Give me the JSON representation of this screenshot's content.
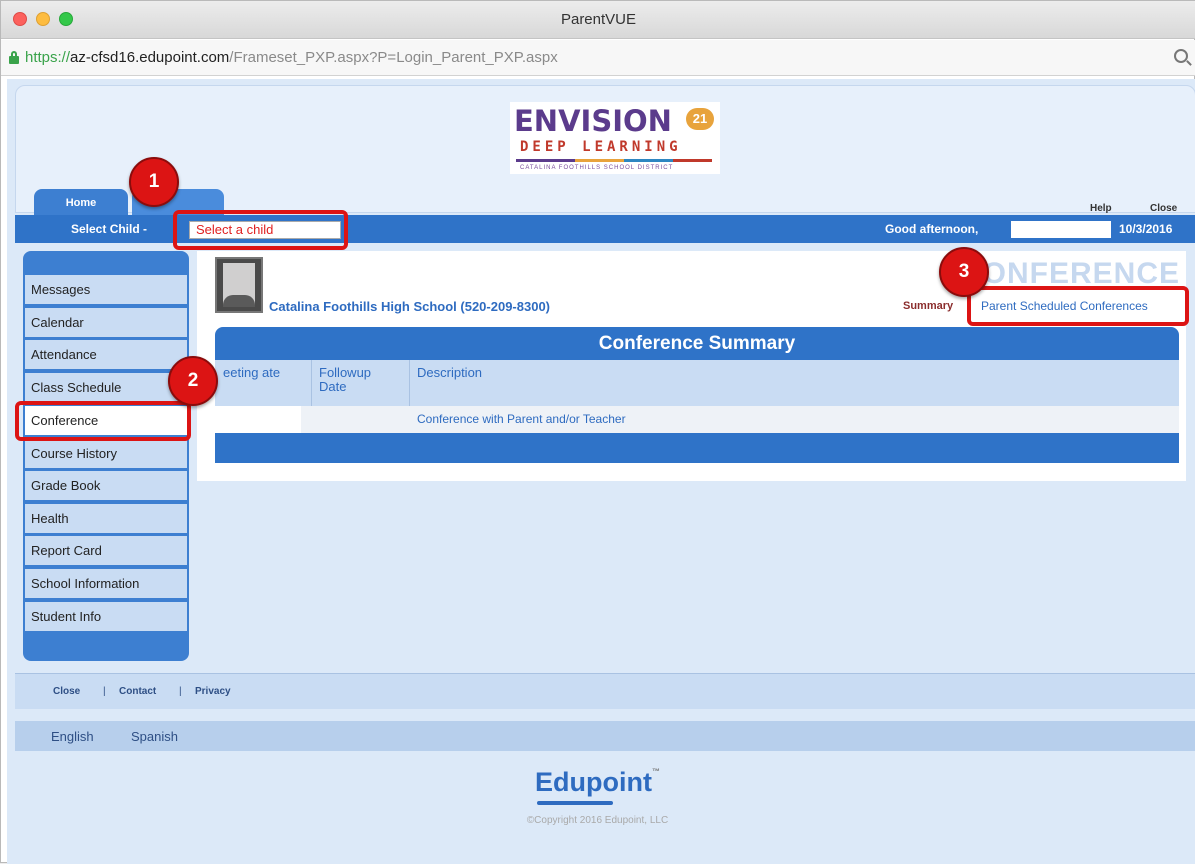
{
  "window": {
    "title": "ParentVUE"
  },
  "urlbar": {
    "scheme": "https://",
    "host": "az-cfsd16.edupoint.com",
    "path": "/Frameset_PXP.aspx?P=Login_Parent_PXP.aspx"
  },
  "logo": {
    "title": "ENVISION",
    "badge": "21",
    "subtitle": "DEEP LEARNING",
    "district": "CATALINA FOOTHILLS SCHOOL DISTRICT"
  },
  "tabs": {
    "home": "Home",
    "second": ""
  },
  "toplinks": {
    "help": "Help",
    "close": "Close"
  },
  "childbar": {
    "label": "Select Child -",
    "select_value": "Select a child",
    "greeting": "Good afternoon,",
    "date": "10/3/2016"
  },
  "sidebar": {
    "items": [
      {
        "label": "Messages"
      },
      {
        "label": "Calendar"
      },
      {
        "label": "Attendance"
      },
      {
        "label": "Class Schedule"
      },
      {
        "label": "Conference"
      },
      {
        "label": "Course History"
      },
      {
        "label": "Grade Book"
      },
      {
        "label": "Health"
      },
      {
        "label": "Report Card"
      },
      {
        "label": "School Information"
      },
      {
        "label": "Student Info"
      }
    ]
  },
  "content": {
    "school": "Catalina Foothills High School (520-209-8300)",
    "watermark": "ONFERENCE",
    "summary_label": "Summary",
    "parent_link": "Parent Scheduled Conferences",
    "table": {
      "title": "Conference Summary",
      "columns": [
        "eeting ate",
        "Followup Date",
        "Description"
      ],
      "rows": [
        {
          "meeting_date": "",
          "followup_date": "",
          "description": "Conference with Parent and/or Teacher"
        }
      ]
    }
  },
  "footer": {
    "links": [
      "Close",
      "Contact",
      "Privacy"
    ],
    "separator": "|",
    "languages": [
      "English",
      "Spanish"
    ],
    "brand": "Edupoint",
    "brand_tm": "™",
    "copyright": "©Copyright 2016 Edupoint, LLC"
  },
  "callouts": [
    "1",
    "2",
    "3"
  ],
  "colors": {
    "accent": "#2f73c8",
    "highlight": "#dc1414",
    "link": "#2e6bc0"
  }
}
